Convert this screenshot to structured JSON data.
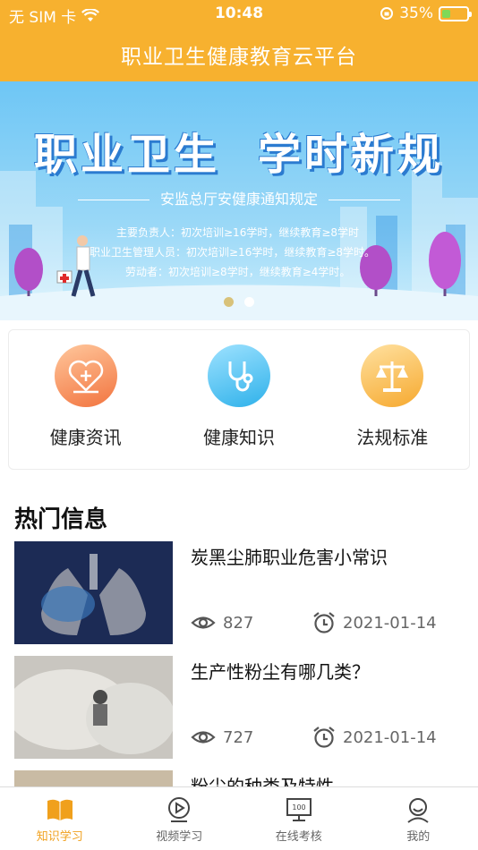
{
  "status_bar": {
    "carrier": "无 SIM 卡",
    "time": "10:48",
    "battery_percent": "35%",
    "battery_level": 0.35
  },
  "header": {
    "title": "职业卫生健康教育云平台"
  },
  "banner": {
    "headline_left": "职业卫生",
    "headline_right": "学时新规",
    "subtitle": "安监总厅安健康通知规定",
    "lines": [
      "主要负责人：初次培训≥16学时，继续教育≥8学时",
      "职业卫生管理人员：初次培训≥16学时，继续教育≥8学时。",
      "劳动者：初次培训≥8学时，继续教育≥4学时。"
    ],
    "page_count": 2,
    "active_page": 1
  },
  "categories": [
    {
      "label": "健康资讯",
      "icon": "heart-plus-icon",
      "color": "#f2743f"
    },
    {
      "label": "健康知识",
      "icon": "stethoscope-icon",
      "color": "#2eb1ea"
    },
    {
      "label": "法规标准",
      "icon": "scales-icon",
      "color": "#f6a92f"
    }
  ],
  "hot_section": {
    "title": "热门信息",
    "items": [
      {
        "title": "炭黑尘肺职业危害小常识",
        "views": "827",
        "date": "2021-01-14"
      },
      {
        "title": "生产性粉尘有哪几类？",
        "views": "727",
        "date": "2021-01-14"
      },
      {
        "title": "粉尘的种类及特性",
        "views": "",
        "date": ""
      }
    ]
  },
  "tabbar": {
    "tabs": [
      {
        "label": "知识学习",
        "icon": "book-icon",
        "active": true
      },
      {
        "label": "视频学习",
        "icon": "play-video-icon",
        "active": false
      },
      {
        "label": "在线考核",
        "icon": "exam-monitor-icon",
        "active": false
      },
      {
        "label": "我的",
        "icon": "user-icon",
        "active": false
      }
    ],
    "active_color": "#f0a01c"
  },
  "colors": {
    "brand": "#f7b12f",
    "banner_blue": "#6ec6f5"
  }
}
